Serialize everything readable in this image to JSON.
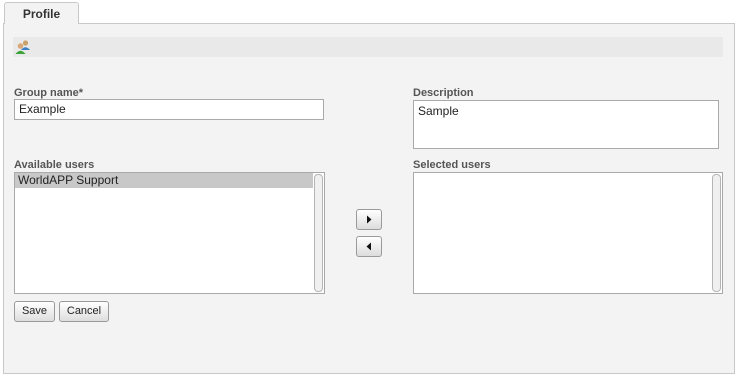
{
  "tabs": [
    {
      "label": "Profile"
    }
  ],
  "form": {
    "group_name": {
      "label": "Group name*",
      "value": "Example"
    },
    "description": {
      "label": "Description",
      "value": "Sample"
    },
    "available_users": {
      "label": "Available users",
      "items": [
        "WorldAPP Support"
      ]
    },
    "selected_users": {
      "label": "Selected users",
      "items": []
    }
  },
  "buttons": {
    "save": "Save",
    "cancel": "Cancel",
    "move_right_icon": "arrow-right-icon",
    "move_left_icon": "arrow-left-icon"
  },
  "icons": {
    "toolbar": "user-group-icon"
  }
}
